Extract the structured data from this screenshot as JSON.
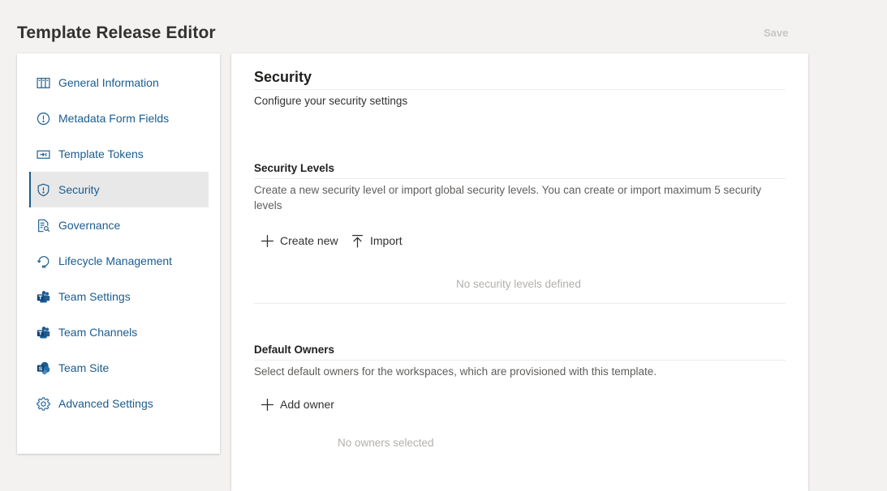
{
  "header": {
    "title": "Template Release Editor",
    "save_label": "Save"
  },
  "sidebar": {
    "items": [
      {
        "label": "General Information",
        "icon": "columns-icon"
      },
      {
        "label": "Metadata Form Fields",
        "icon": "info-circle-icon"
      },
      {
        "label": "Template Tokens",
        "icon": "token-icon"
      },
      {
        "label": "Security",
        "icon": "shield-icon",
        "active": true
      },
      {
        "label": "Governance",
        "icon": "document-search-icon"
      },
      {
        "label": "Lifecycle Management",
        "icon": "lifecycle-icon"
      },
      {
        "label": "Team Settings",
        "icon": "teams-icon"
      },
      {
        "label": "Team Channels",
        "icon": "teams-icon"
      },
      {
        "label": "Team Site",
        "icon": "sharepoint-icon"
      },
      {
        "label": "Advanced Settings",
        "icon": "gear-icon"
      }
    ]
  },
  "main": {
    "title": "Security",
    "description": "Configure your security settings",
    "security_levels": {
      "title": "Security Levels",
      "description": "Create a new security level or import global security levels. You can create or import maximum 5 security levels",
      "create_label": "Create new",
      "import_label": "Import",
      "empty_text": "No security levels defined"
    },
    "default_owners": {
      "title": "Default Owners",
      "description": "Select default owners for the workspaces, which are provisioned with this template.",
      "add_label": "Add owner",
      "empty_text": "No owners selected"
    }
  },
  "colors": {
    "accent": "#1a5c8f",
    "background": "#f3f2f1",
    "active_item_bg": "#e8e8e8",
    "muted_text": "#b3b0ad"
  }
}
